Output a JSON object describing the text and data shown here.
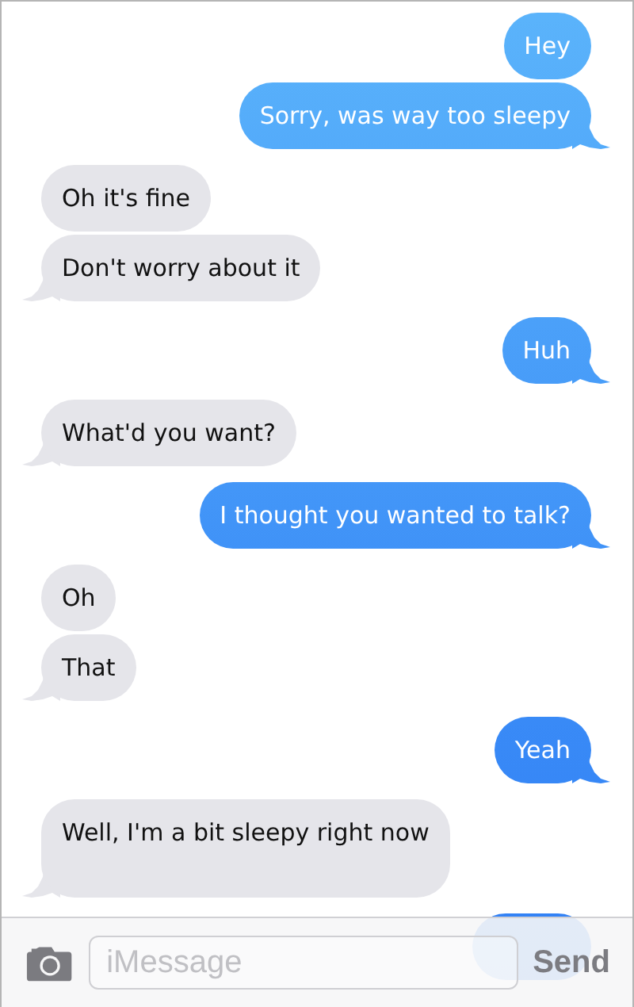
{
  "messages": [
    {
      "kind": "sent",
      "text": "Hey",
      "tail": false
    },
    {
      "kind": "sent",
      "text": "Sorry, was way too sleepy",
      "tail": true
    },
    {
      "kind": "received",
      "text": "Oh it's fine",
      "tail": false
    },
    {
      "kind": "received",
      "text": "Don't worry about it",
      "tail": true
    },
    {
      "kind": "sent",
      "text": "Huh",
      "tail": true
    },
    {
      "kind": "received",
      "text": "What'd you want?",
      "tail": true
    },
    {
      "kind": "sent",
      "text": "I thought you wanted to talk?",
      "tail": true
    },
    {
      "kind": "received",
      "text": "Oh",
      "tail": false
    },
    {
      "kind": "received",
      "text": "That",
      "tail": true
    },
    {
      "kind": "sent",
      "text": "Yeah",
      "tail": true
    },
    {
      "kind": "received",
      "text": "Well, I'm a bit sleepy right now",
      "tail": true,
      "tall": true
    },
    {
      "kind": "sent",
      "tail": false
    }
  ],
  "composer": {
    "placeholder": "iMessage",
    "send": "Send"
  }
}
